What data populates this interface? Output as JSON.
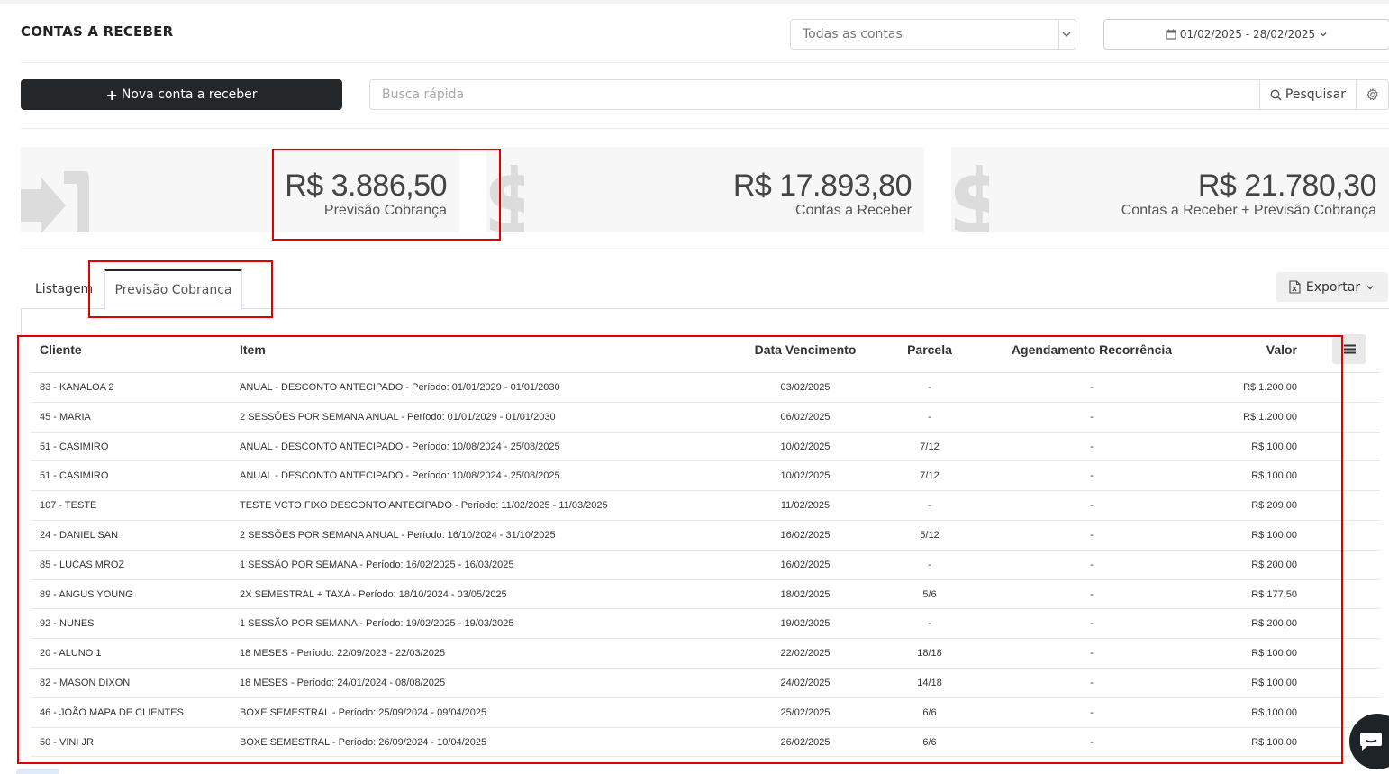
{
  "header": {
    "title": "CONTAS A RECEBER",
    "account_filter": "Todas as contas",
    "date_range": "01/02/2025 - 28/02/2025"
  },
  "toolbar": {
    "new_button": "Nova conta a receber",
    "search_placeholder": "Busca rápida",
    "search_button": "Pesquisar"
  },
  "cards": [
    {
      "amount": "R$ 3.886,50",
      "caption": "Previsão Cobrança",
      "icon": "sign-in-icon"
    },
    {
      "amount": "R$ 17.893,80",
      "caption": "Contas a Receber",
      "icon": "dollar-icon"
    },
    {
      "amount": "R$ 21.780,30",
      "caption": "Contas a Receber + Previsão Cobrança",
      "icon": "dollar-icon"
    }
  ],
  "tabs": {
    "listagem": "Listagem",
    "previsao": "Previsão Cobrança",
    "active": "previsao"
  },
  "export_button": "Exportar",
  "table": {
    "columns": [
      "Cliente",
      "Item",
      "Data Vencimento",
      "Parcela",
      "Agendamento Recorrência",
      "Valor"
    ],
    "rows": [
      [
        "83 - KANALOA 2",
        "ANUAL - DESCONTO ANTECIPADO - Período: 01/01/2029 - 01/01/2030",
        "03/02/2025",
        "-",
        "-",
        "R$ 1.200,00"
      ],
      [
        "45 - MARIA",
        "2 SESSÕES POR SEMANA ANUAL - Período: 01/01/2029 - 01/01/2030",
        "06/02/2025",
        "-",
        "-",
        "R$ 1.200,00"
      ],
      [
        "51 - CASIMIRO",
        "ANUAL - DESCONTO ANTECIPADO - Período: 10/08/2024 - 25/08/2025",
        "10/02/2025",
        "7/12",
        "-",
        "R$ 100,00"
      ],
      [
        "51 - CASIMIRO",
        "ANUAL - DESCONTO ANTECIPADO - Período: 10/08/2024 - 25/08/2025",
        "10/02/2025",
        "7/12",
        "-",
        "R$ 100,00"
      ],
      [
        "107 - TESTE",
        "TESTE VCTO FIXO DESCONTO ANTECIPADO - Período: 11/02/2025 - 11/03/2025",
        "11/02/2025",
        "-",
        "-",
        "R$ 209,00"
      ],
      [
        "24 - DANIEL SAN",
        "2 SESSÕES POR SEMANA ANUAL - Período: 16/10/2024 - 31/10/2025",
        "16/02/2025",
        "5/12",
        "-",
        "R$ 100,00"
      ],
      [
        "85 - LUCAS MROZ",
        "1 SESSÃO POR SEMANA - Período: 16/02/2025 - 16/03/2025",
        "16/02/2025",
        "-",
        "-",
        "R$ 200,00"
      ],
      [
        "89 - ANGUS YOUNG",
        "2X SEMESTRAL + TAXA - Período: 18/10/2024 - 03/05/2025",
        "18/02/2025",
        "5/6",
        "-",
        "R$ 177,50"
      ],
      [
        "92 - NUNES",
        "1 SESSÃO POR SEMANA - Período: 19/02/2025 - 19/03/2025",
        "19/02/2025",
        "-",
        "-",
        "R$ 200,00"
      ],
      [
        "20 - ALUNO 1",
        "18 MESES - Período: 22/09/2023 - 22/03/2025",
        "22/02/2025",
        "18/18",
        "-",
        "R$ 100,00"
      ],
      [
        "82 - MASON DIXON",
        "18 MESES - Período: 24/01/2024 - 08/08/2025",
        "24/02/2025",
        "14/18",
        "-",
        "R$ 100,00"
      ],
      [
        "46 - JOÃO MAPA DE CLIENTES",
        "BOXE SEMESTRAL - Período: 25/09/2024 - 09/04/2025",
        "25/02/2025",
        "6/6",
        "-",
        "R$ 100,00"
      ],
      [
        "50 - VINI JR",
        "BOXE SEMESTRAL - Período: 26/09/2024 - 10/04/2025",
        "26/02/2025",
        "6/6",
        "-",
        "R$ 100,00"
      ]
    ]
  },
  "colors": {
    "dark": "#23272a",
    "highlight": "#e00000",
    "card_bg": "#f7f7f7"
  }
}
